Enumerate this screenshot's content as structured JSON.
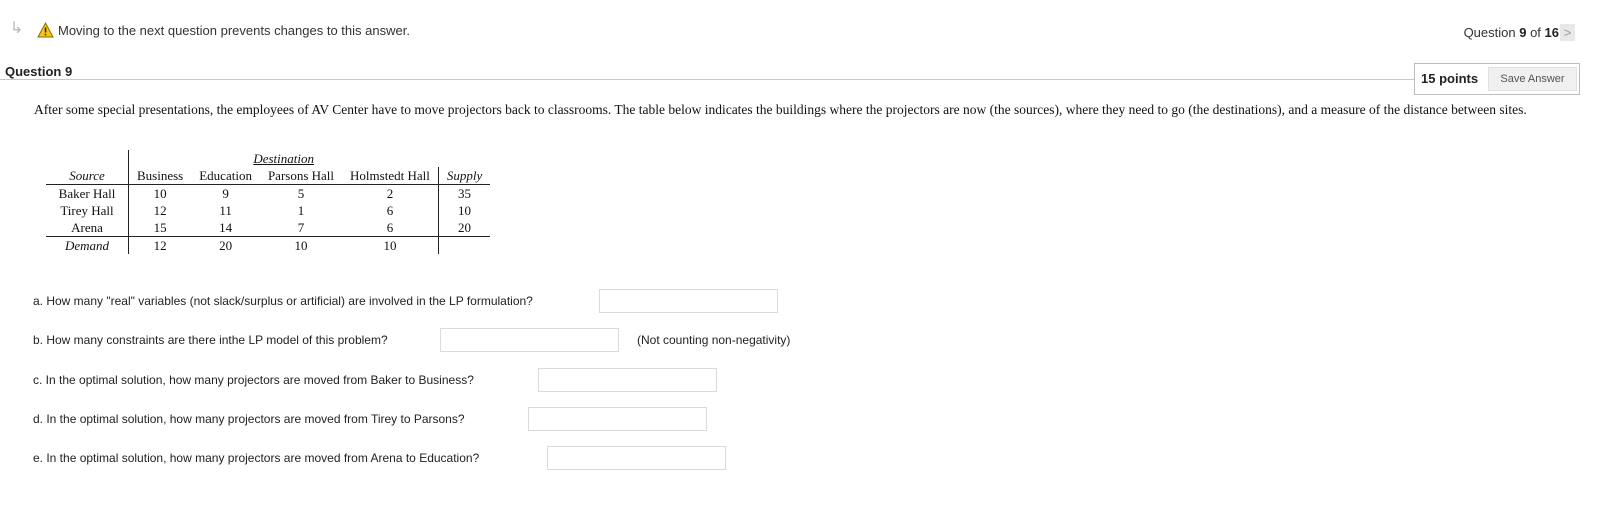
{
  "topbar": {
    "return_arrow": "↳",
    "warning_icon": "warning-triangle-icon",
    "warning_text": "Moving to the next question prevents changes to this answer.",
    "qnav_prefix": "Question ",
    "qnav_current": "9",
    "qnav_middle": " of ",
    "qnav_total": "16",
    "next_label": ">"
  },
  "question": {
    "title": "Question 9",
    "points": "15 points",
    "save_label": "Save Answer",
    "intro": "After some special presentations, the employees of AV Center have to move projectors back to classrooms. The table below indicates the buildings where the projectors are now (the sources), where they need to go (the destinations), and a measure of the distance between sites."
  },
  "table": {
    "destination_label": "Destination",
    "source_label": "Source",
    "supply_label": "Supply",
    "columns": [
      "Business",
      "Education",
      "Parsons Hall",
      "Holmstedt Hall"
    ],
    "rows": [
      {
        "name": "Baker Hall",
        "values": [
          "10",
          "9",
          "5",
          "2"
        ],
        "supply": "35"
      },
      {
        "name": "Tirey Hall",
        "values": [
          "12",
          "11",
          "1",
          "6"
        ],
        "supply": "10"
      },
      {
        "name": "Arena",
        "values": [
          "15",
          "14",
          "7",
          "6"
        ],
        "supply": "20"
      }
    ],
    "demand_label": "Demand",
    "demand": [
      "12",
      "20",
      "10",
      "10"
    ]
  },
  "parts": {
    "a": "a. How many \"real\" variables (not slack/surplus or artificial) are involved in the LP formulation?",
    "b": "b. How many constraints are there inthe LP model of this problem?",
    "b_note": "(Not counting non-negativity)",
    "c": "c. In the optimal solution, how many projectors are moved from Baker to Business?",
    "d": "d. In the optimal solution, how many projectors are moved from Tirey to Parsons?",
    "e": "e. In the optimal solution, how many projectors are moved from Arena to Education?"
  },
  "answers": {
    "a": "",
    "b": "",
    "c": "",
    "d": "",
    "e": ""
  }
}
